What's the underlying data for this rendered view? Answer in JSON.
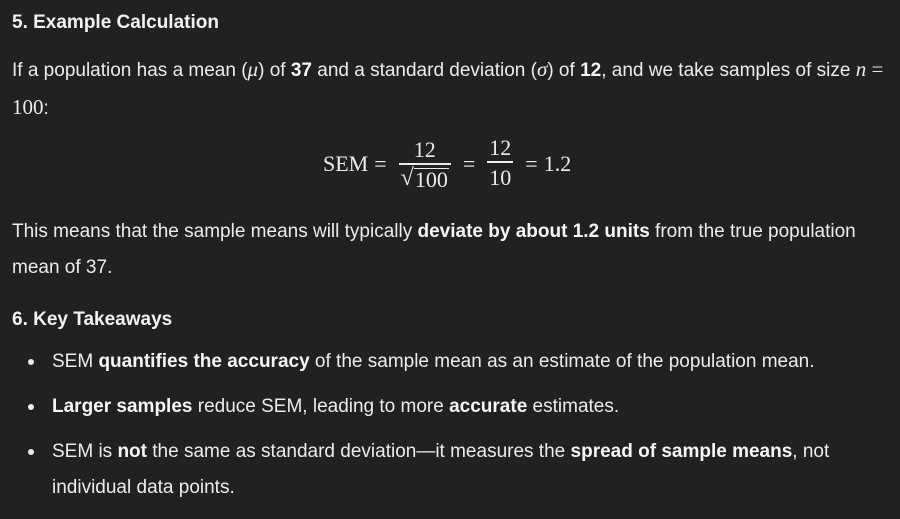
{
  "section5": {
    "heading": "5. Example Calculation",
    "intro": {
      "t1": "If a population has a mean (",
      "mu": "μ",
      "t2": ") of ",
      "mean_value": "37",
      "t3": " and a standard deviation (",
      "sigma": "σ",
      "t4": ") of ",
      "sd_value": "12",
      "t5": ", and we take samples of size ",
      "n_var": "n",
      "n_eq": " = 100",
      "t6": ":"
    },
    "equation": {
      "lhs": "SEM",
      "eq1": "=",
      "frac1_num": "12",
      "frac1_den_sqrt": "√",
      "frac1_den_arg": "100",
      "eq2": "=",
      "frac2_num": "12",
      "frac2_den": "10",
      "eq3": "=",
      "result": "1.2"
    },
    "meaning": {
      "t1": "This means that the sample means will typically ",
      "bold": "deviate by about 1.2 units",
      "t2": " from the true population mean of 37."
    }
  },
  "section6": {
    "heading": "6. Key Takeaways",
    "bullets": [
      {
        "t1": "SEM ",
        "b1": "quantifies the accuracy",
        "t2": " of the sample mean as an estimate of the population mean."
      },
      {
        "b1": "Larger samples",
        "t1": " reduce SEM, leading to more ",
        "b2": "accurate",
        "t2": " estimates."
      },
      {
        "t1": "SEM is ",
        "b1": "not",
        "t2": " the same as standard deviation—it measures the ",
        "b2": "spread of sample means",
        "t3": ", not individual data points."
      }
    ]
  }
}
